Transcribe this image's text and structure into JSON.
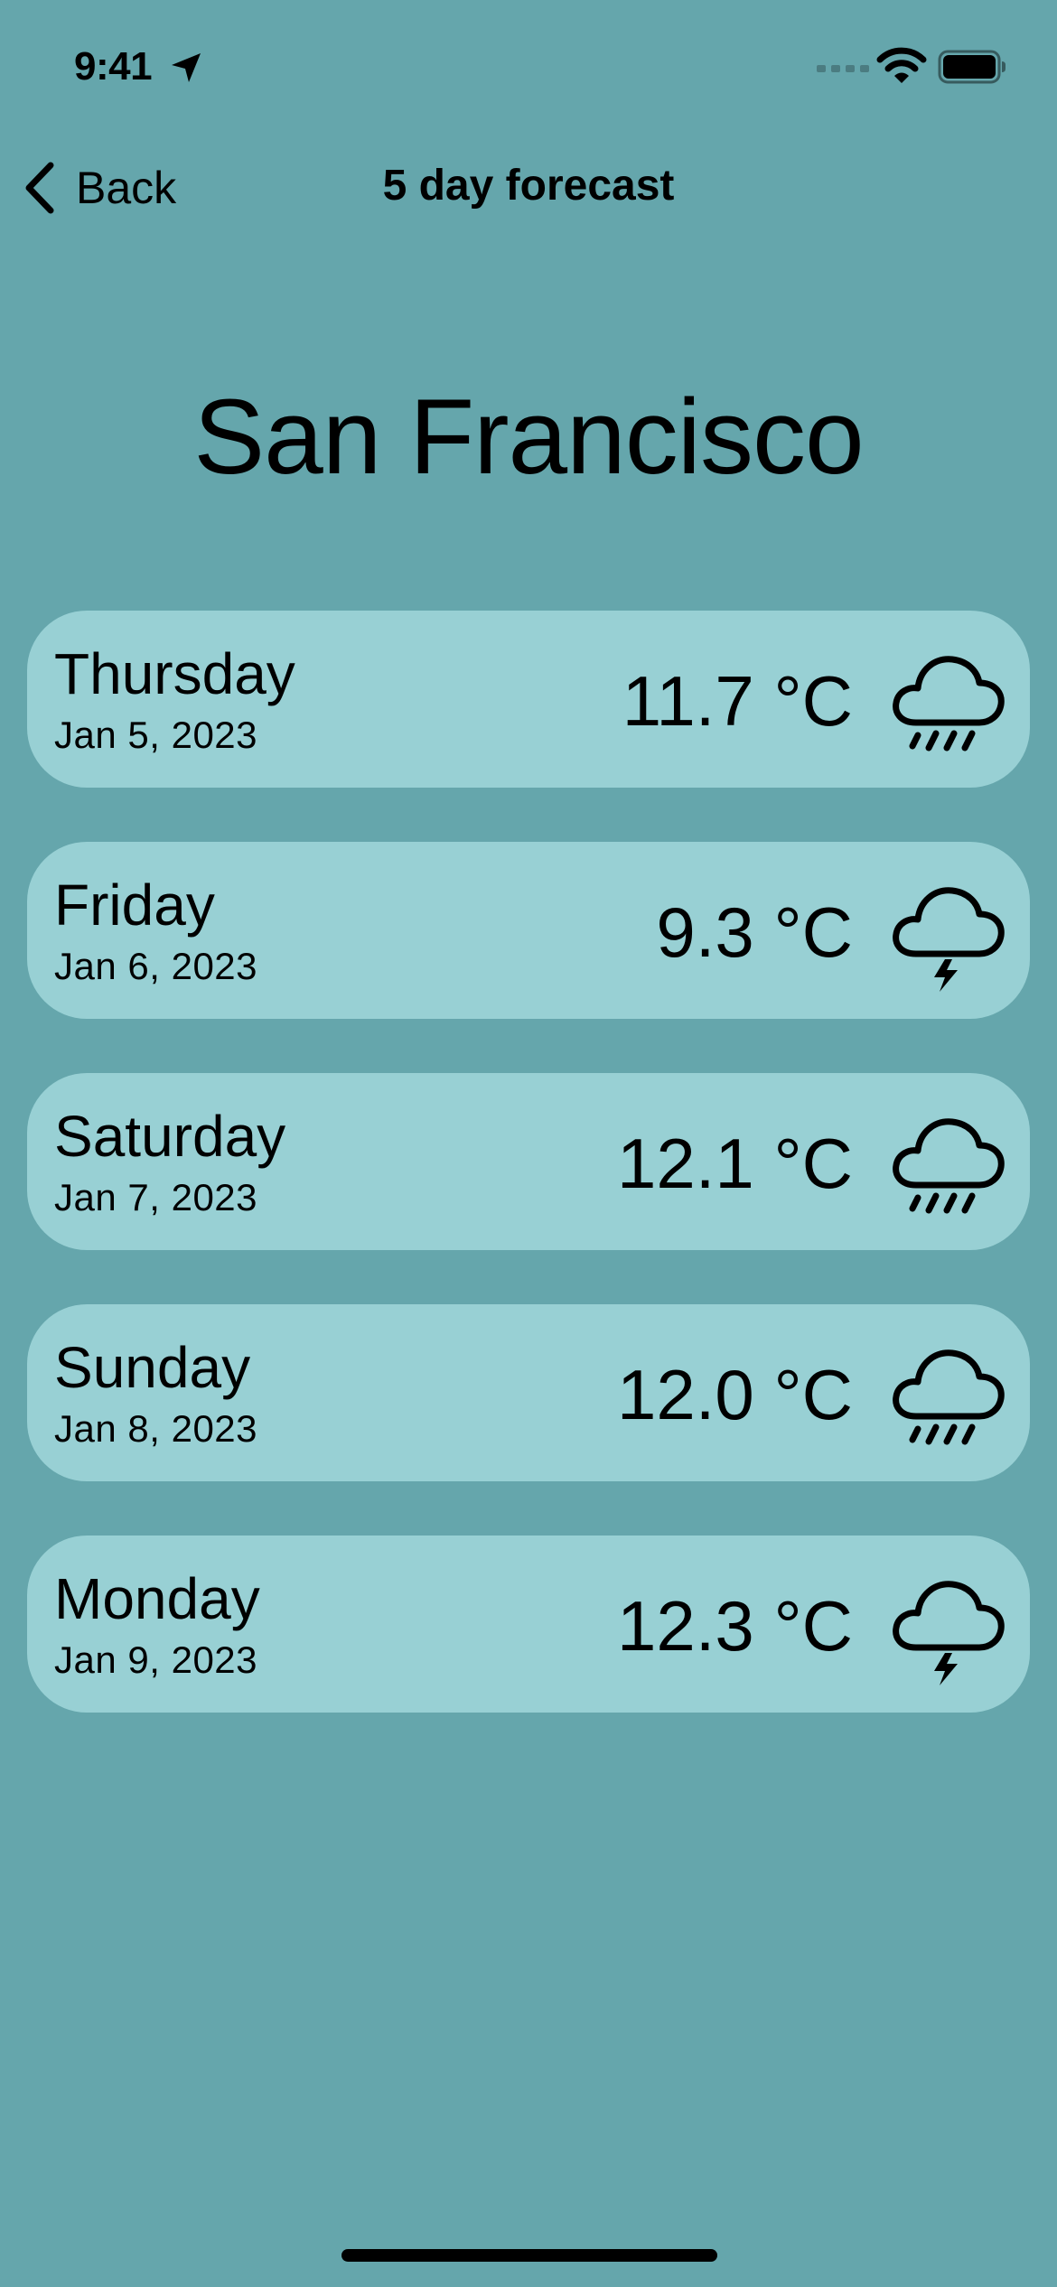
{
  "status_bar": {
    "time": "9:41"
  },
  "nav": {
    "back_label": "Back",
    "title": "5 day forecast"
  },
  "city": "San Francisco",
  "forecast": [
    {
      "day": "Thursday",
      "date": "Jan 5, 2023",
      "temp": "11.7 °C",
      "icon": "rain-cloud-icon"
    },
    {
      "day": "Friday",
      "date": "Jan 6, 2023",
      "temp": "9.3 °C",
      "icon": "thunderstorm-cloud-icon"
    },
    {
      "day": "Saturday",
      "date": "Jan 7, 2023",
      "temp": "12.1 °C",
      "icon": "rain-cloud-icon"
    },
    {
      "day": "Sunday",
      "date": "Jan 8, 2023",
      "temp": "12.0 °C",
      "icon": "rain-cloud-icon"
    },
    {
      "day": "Monday",
      "date": "Jan 9, 2023",
      "temp": "12.3 °C",
      "icon": "thunderstorm-cloud-icon"
    }
  ],
  "colors": {
    "background": "#65a6ac",
    "card": "#98d0d4",
    "text": "#000000"
  }
}
